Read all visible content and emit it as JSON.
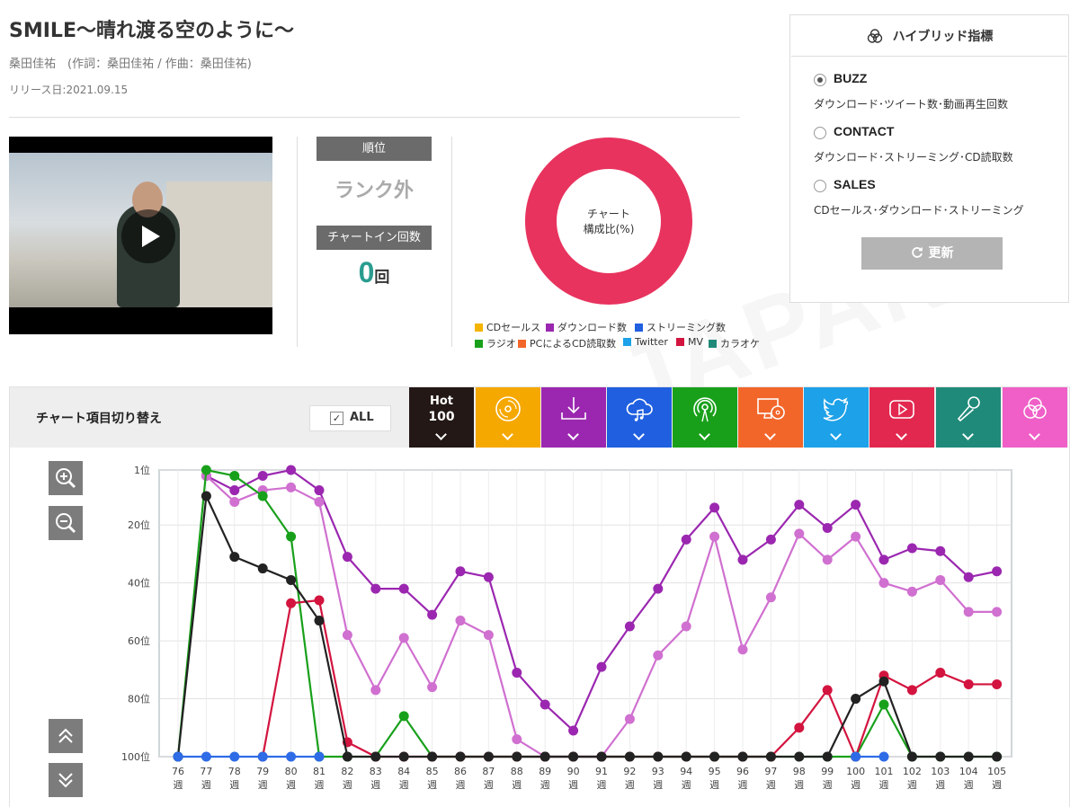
{
  "song": {
    "title": "SMILE〜晴れ渡る空のように〜",
    "artist_line": "桑田佳祐　(作詞：桑田佳祐 / 作曲：桑田佳祐)",
    "release": "リリース日:2021.09.15"
  },
  "rank": {
    "label": "順位",
    "value": "ランク外",
    "chartin_label": "チャートイン回数",
    "chartin_value": "0",
    "chartin_unit": "回"
  },
  "donut": {
    "center_line1": "チャート",
    "center_line2": "構成比(%)",
    "color": "#e8335e"
  },
  "legend": [
    {
      "label": "CDセールス",
      "color": "#f5b400"
    },
    {
      "label": "ダウンロード数",
      "color": "#9b27b0"
    },
    {
      "label": "ストリーミング数",
      "color": "#1f5fe0"
    },
    {
      "label": "ラジオ",
      "color": "#19a01b"
    },
    {
      "label": "PCによるCD読取数",
      "color": "#f2662a"
    },
    {
      "label": "Twitter",
      "color": "#1da1e8"
    },
    {
      "label": "MV",
      "color": "#d3143f"
    },
    {
      "label": "カラオケ",
      "color": "#1f8a7a"
    }
  ],
  "hybrid": {
    "title": "ハイブリッド指標",
    "options": [
      {
        "label": "BUZZ",
        "desc": "ダウンロード･ツイート数･動画再生回数",
        "selected": true
      },
      {
        "label": "CONTACT",
        "desc": "ダウンロード･ストリーミング･CD読取数",
        "selected": false
      },
      {
        "label": "SALES",
        "desc": "CDセールス･ダウンロード･ストリーミング",
        "selected": false
      }
    ],
    "update_label": "更新"
  },
  "chart_toggle": {
    "label": "チャート項目切り替え",
    "all_label": "ALL",
    "all_checked": true,
    "tabs": [
      {
        "name": "hot100",
        "text1": "Hot",
        "text2": "100",
        "color": "#231815",
        "icon": "hot100-text"
      },
      {
        "name": "cd-sales",
        "color": "#f5a800",
        "icon": "cd-icon"
      },
      {
        "name": "download",
        "color": "#9b27b0",
        "icon": "download-icon"
      },
      {
        "name": "streaming",
        "color": "#1f5fe0",
        "icon": "cloud-music-icon"
      },
      {
        "name": "radio",
        "color": "#19a01b",
        "icon": "radio-icon"
      },
      {
        "name": "pc-cd-read",
        "color": "#f2662a",
        "icon": "pc-cd-icon"
      },
      {
        "name": "twitter",
        "color": "#1da1e8",
        "icon": "twitter-icon"
      },
      {
        "name": "mv",
        "color": "#e2284f",
        "icon": "youtube-icon"
      },
      {
        "name": "karaoke",
        "color": "#1f8a7a",
        "icon": "microphone-icon"
      },
      {
        "name": "hybrid",
        "color": "#ef5fc7",
        "icon": "venn-icon"
      }
    ]
  },
  "chart_data": {
    "type": "line",
    "x": [
      76,
      77,
      78,
      79,
      80,
      81,
      82,
      83,
      84,
      85,
      86,
      87,
      88,
      89,
      90,
      91,
      92,
      93,
      94,
      95,
      96,
      97,
      98,
      99,
      100,
      101,
      102,
      103,
      104,
      105
    ],
    "x_suffix": "週",
    "y_ticks": [
      1,
      20,
      40,
      60,
      80,
      100
    ],
    "y_tick_suffix": "位",
    "ylim": [
      1,
      100
    ],
    "y_inverted": true,
    "grid": true,
    "series": [
      {
        "color": "#9b27b0",
        "values": [
          null,
          3,
          8,
          3,
          1,
          8,
          31,
          42,
          42,
          51,
          36,
          38,
          71,
          82,
          91,
          69,
          55,
          42,
          25,
          14,
          32,
          25,
          13,
          21,
          13,
          32,
          28,
          29,
          38,
          36
        ]
      },
      {
        "color": "#d070d0",
        "values": [
          null,
          3,
          12,
          8,
          7,
          12,
          58,
          77,
          59,
          76,
          53,
          58,
          94,
          100,
          100,
          100,
          87,
          65,
          55,
          24,
          63,
          45,
          23,
          32,
          24,
          40,
          43,
          39,
          50,
          50
        ]
      },
      {
        "color": "#19a01b",
        "values": [
          100,
          1,
          3,
          10,
          24,
          100,
          100,
          100,
          86,
          100,
          100,
          100,
          100,
          100,
          100,
          100,
          100,
          100,
          100,
          100,
          100,
          100,
          100,
          100,
          100,
          82,
          100,
          100,
          100,
          100
        ]
      },
      {
        "color": "#d3143f",
        "values": [
          null,
          null,
          null,
          100,
          47,
          46,
          95,
          100,
          100,
          100,
          100,
          100,
          100,
          100,
          100,
          100,
          100,
          100,
          100,
          100,
          100,
          100,
          90,
          77,
          100,
          72,
          77,
          71,
          75,
          75
        ]
      },
      {
        "color": "#222222",
        "values": [
          100,
          10,
          31,
          35,
          39,
          53,
          100,
          100,
          100,
          100,
          100,
          100,
          100,
          100,
          100,
          100,
          100,
          100,
          100,
          100,
          100,
          100,
          100,
          100,
          80,
          74,
          100,
          100,
          100,
          100
        ]
      },
      {
        "color": "#2e6be6",
        "values": [
          100,
          100,
          100,
          100,
          100,
          100,
          null,
          null,
          null,
          null,
          null,
          null,
          null,
          null,
          null,
          null,
          null,
          null,
          null,
          null,
          null,
          null,
          null,
          null,
          100,
          100,
          null,
          null,
          null,
          null
        ]
      }
    ]
  }
}
